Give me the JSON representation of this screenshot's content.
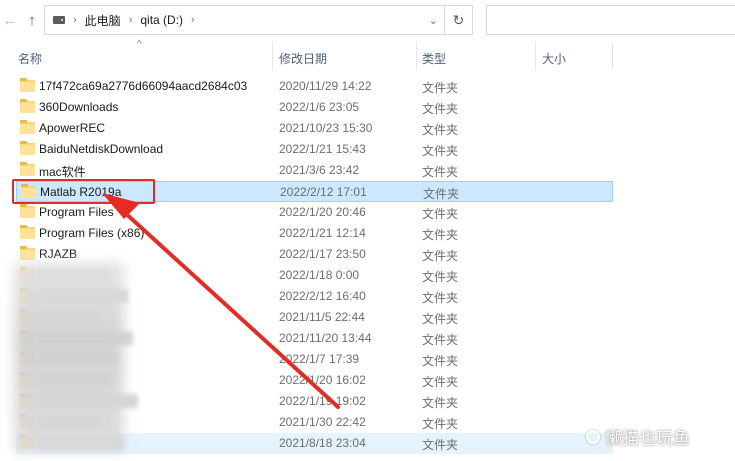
{
  "toolbar": {
    "back_icon": "arrow-left-icon",
    "forward_icon": "arrow-right-icon",
    "recent_icon": "chevron-down-icon",
    "up_icon": "arrow-up-icon",
    "drive_icon": "drive-icon",
    "refresh_icon": "refresh-icon",
    "back_glyph": "←",
    "forward_glyph": "→",
    "recent_glyph": "⌄",
    "up_glyph": "↑",
    "refresh_glyph": "↻",
    "sep_glyph": "›"
  },
  "breadcrumb": [
    "此电脑",
    "qita (D:)"
  ],
  "search": {
    "placeholder": ""
  },
  "columns": [
    "名称",
    "修改日期",
    "类型",
    "大小"
  ],
  "files": [
    {
      "name": "17f472ca69a2776d66094aacd2684c03",
      "date": "2020/11/29 14:22",
      "type": "文件夹"
    },
    {
      "name": "360Downloads",
      "date": "2022/1/6 23:05",
      "type": "文件夹"
    },
    {
      "name": "ApowerREC",
      "date": "2021/10/23 15:30",
      "type": "文件夹"
    },
    {
      "name": "BaiduNetdiskDownload",
      "date": "2022/1/21 15:43",
      "type": "文件夹"
    },
    {
      "name": "mac软件",
      "date": "2021/3/6 23:42",
      "type": "文件夹"
    },
    {
      "name": "Matlab R2019a",
      "date": "2022/2/12 17:01",
      "type": "文件夹",
      "selected": true
    },
    {
      "name": "Program Files",
      "date": "2022/1/20 20:46",
      "type": "文件夹"
    },
    {
      "name": "Program Files (x86)",
      "date": "2022/1/21 12:14",
      "type": "文件夹"
    },
    {
      "name": "RJAZB",
      "date": "2022/1/17 23:50",
      "type": "文件夹"
    },
    {
      "name": "",
      "date": "2022/1/18 0:00",
      "type": "文件夹"
    },
    {
      "name": "",
      "date": "2022/2/12 16:40",
      "type": "文件夹"
    },
    {
      "name": "",
      "date": "2021/11/5 22:44",
      "type": "文件夹"
    },
    {
      "name": "",
      "date": "2021/11/20 13:44",
      "type": "文件夹"
    },
    {
      "name": "",
      "date": "2022/1/7 17:39",
      "type": "文件夹"
    },
    {
      "name": "",
      "date": "2022/1/20 16:02",
      "type": "文件夹"
    },
    {
      "name": "",
      "date": "2022/1/19 19:02",
      "type": "文件夹"
    },
    {
      "name": "",
      "date": "2021/1/30 22:42",
      "type": "文件夹"
    },
    {
      "name": "",
      "date": "2021/8/18 23:04",
      "type": "文件夹",
      "hover": true
    }
  ],
  "watermark": "懒猫也玩鱼",
  "colors": {
    "selection": "#cce8ff",
    "selection_border": "#99d1ff",
    "annotation_red": "#e52b26",
    "folder_yellow": "#f8d775"
  }
}
